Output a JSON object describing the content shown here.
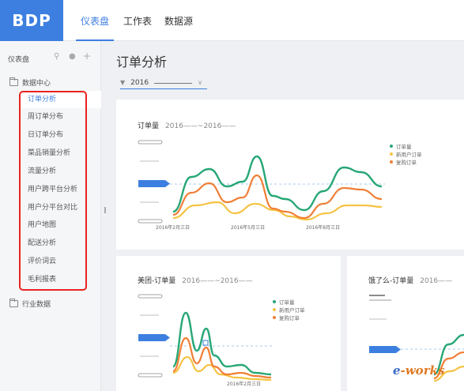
{
  "topbar": {
    "logo": "BDP",
    "tabs": [
      {
        "label": "仪表盘",
        "active": true
      },
      {
        "label": "工作表",
        "active": false
      },
      {
        "label": "数据源",
        "active": false
      }
    ]
  },
  "sidebar": {
    "heading": "仪表盘",
    "tools": [
      "search-icon",
      "pin-icon",
      "plus-icon"
    ],
    "folders": [
      "数据中心",
      "行业数据"
    ],
    "items": [
      "订单分析",
      "周订单分布",
      "日订单分布",
      "菜品销量分析",
      "流量分析",
      "用户跨平台分析",
      "用户分平台对比",
      "用户地图",
      "配送分析",
      "评价词云",
      "毛利报表"
    ],
    "active_index": 0
  },
  "main": {
    "title": "订单分析",
    "filter": {
      "value": "2016"
    }
  },
  "cards": [
    {
      "title": "订单量",
      "range": "2016——~2016——",
      "legend": [
        "订单量",
        "新用户订单",
        "复购订单"
      ],
      "dates": [
        "2016年2月三日",
        "2016年5月三日",
        "2016年8月三日"
      ]
    },
    {
      "title": "美团-订单量",
      "range": "2016——~2016——",
      "legend": [
        "订单量",
        "新用户订单",
        "复购订单"
      ],
      "dates": [
        "2016年2月三日"
      ]
    },
    {
      "title": "饿了么-订单量",
      "range": "2016——"
    }
  ],
  "colors": {
    "accent": "#3d7fe0",
    "series_total": "#27a776",
    "series_new": "#f5c343",
    "series_repeat": "#f07f36",
    "highlight_box": "#e8241f"
  },
  "watermark": {
    "e": "e",
    "rest": "-works"
  },
  "chart_data": [
    {
      "type": "line",
      "title": "订单量",
      "x": [
        "2016年2月三日",
        "2016年5月三日",
        "2016年8月三日"
      ],
      "series": [
        {
          "name": "订单量"
        },
        {
          "name": "新用户订单"
        },
        {
          "name": "复购订单"
        }
      ]
    },
    {
      "type": "line",
      "title": "美团-订单量",
      "x": [
        "2016年2月三日"
      ],
      "series": [
        {
          "name": "订单量"
        },
        {
          "name": "新用户订单"
        },
        {
          "name": "复购订单"
        }
      ]
    }
  ]
}
